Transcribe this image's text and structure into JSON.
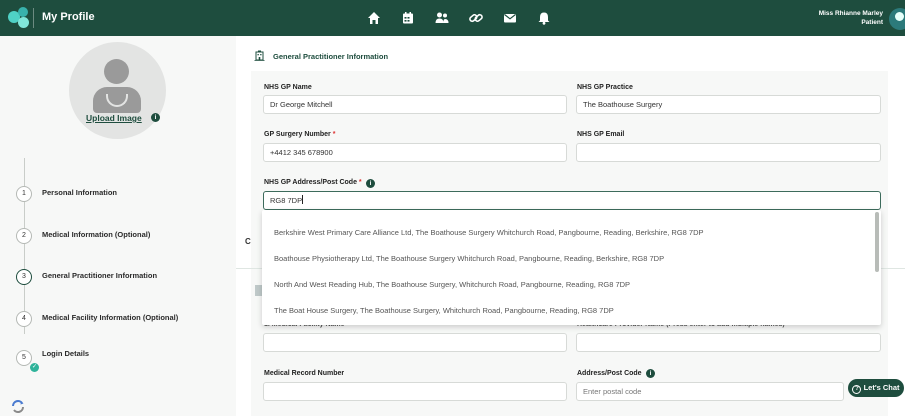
{
  "header": {
    "title": "My Profile",
    "nav_icons": [
      "home-icon",
      "calendar-icon",
      "people-icon",
      "link-icon",
      "mail-icon",
      "bell-icon"
    ],
    "user_name": "Miss Rhianne Marley",
    "user_role": "Patient"
  },
  "sidebar": {
    "upload_label": "Upload Image",
    "info_glyph": "i",
    "steps": [
      {
        "number": "1",
        "label": "Personal Information"
      },
      {
        "number": "2",
        "label": "Medical Information (Optional)"
      },
      {
        "number": "3",
        "label": "General Practitioner Information"
      },
      {
        "number": "4",
        "label": "Medical Facility Information (Optional)"
      },
      {
        "number": "5",
        "label": "Login Details"
      }
    ],
    "check_glyph": "✓"
  },
  "gp_section": {
    "title": "General Practitioner Information",
    "gp_name_label": "NHS GP Name",
    "gp_name_value": "Dr George Mitchell",
    "gp_practice_label": "NHS GP Practice",
    "gp_practice_value": "The Boathouse Surgery",
    "surgery_number_label": "GP Surgery Number",
    "surgery_number_value": "+4412 345 678900",
    "gp_email_label": "NHS GP Email",
    "gp_email_value": "",
    "address_label": "NHS GP Address/Post Code",
    "address_value": "RG8 7DP",
    "required_mark": "*"
  },
  "dropdown": {
    "options": [
      "Berkshire West Primary Care Alliance Ltd, The Boathouse Surgery Whitchurch Road, Pangbourne, Reading, Berkshire, RG8 7DP",
      "Boathouse Physiotherapy Ltd, The Boathouse Surgery Whitchurch Road, Pangbourne, Reading, Berkshire, RG8 7DP",
      "North And West Reading Hub, The Boathouse Surgery, Whitchurch Road, Pangbourne, Reading, RG8 7DP",
      "The Boat House Surgery, The Boathouse Surgery, Whitchurch Road, Pangbourne, Reading, RG8 7DP"
    ]
  },
  "facility_section": {
    "partial_heading": "C",
    "facility_name_label": "1. Medical Facility Name",
    "provider_label": "Healthcare Provider Name (Press enter to add multiple names)",
    "record_number_label": "Medical Record Number",
    "postcode_label": "Address/Post Code",
    "postcode_placeholder": "Enter postal code"
  },
  "chat": {
    "label": "Let's Chat",
    "icon_glyph": "?"
  },
  "colors": {
    "header_bg": "#1e4d3e",
    "accent": "#1e4d3e",
    "success": "#2fb39a",
    "required": "#dd3333"
  }
}
